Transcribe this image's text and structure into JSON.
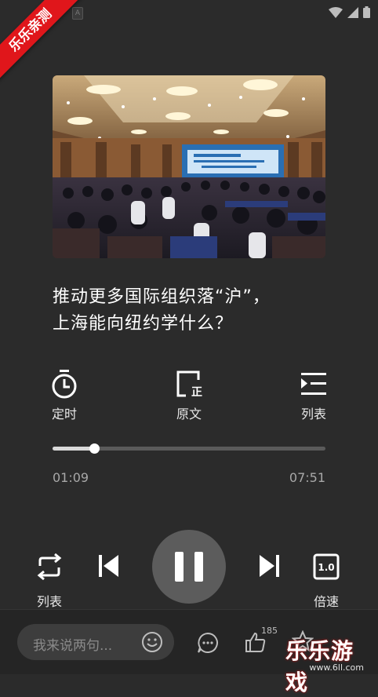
{
  "ribbon": {
    "text": "乐乐亲测"
  },
  "article": {
    "title_line1": "推动更多国际组织落“沪”，",
    "title_line2": "上海能向纽约学什么？"
  },
  "actions": {
    "timer_label": "定时",
    "original_label": "原文",
    "list_label": "列表"
  },
  "player": {
    "current_time": "01:09",
    "total_time": "07:51",
    "progress_fraction": 0.153,
    "loop_label": "列表",
    "speed_label": "倍速",
    "speed_value": "1.0"
  },
  "bottom_bar": {
    "comment_placeholder": "我来说两句...",
    "like_count": "185"
  },
  "watermark": {
    "main": "乐乐游戏",
    "sub": "www.6ll.com"
  }
}
